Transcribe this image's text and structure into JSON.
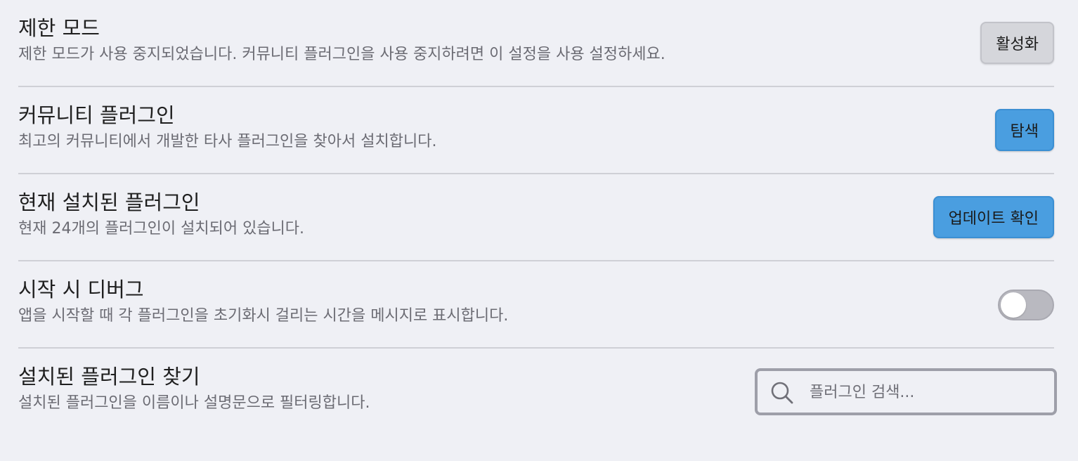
{
  "settings": {
    "restricted_mode": {
      "name": "제한 모드",
      "desc": "제한 모드가 사용 중지되었습니다. 커뮤니티 플러그인을 사용 중지하려면 이 설정을 사용 설정하세요.",
      "button": "활성화"
    },
    "community_plugins": {
      "name": "커뮤니티 플러그인",
      "desc": "최고의 커뮤니티에서 개발한 타사 플러그인을 찾아서 설치합니다.",
      "button": "탐색"
    },
    "installed_plugins": {
      "name": "현재 설치된 플러그인",
      "desc": "현재 24개의 플러그인이 설치되어 있습니다.",
      "button": "업데이트 확인"
    },
    "debug_startup": {
      "name": "시작 시 디버그",
      "desc": "앱을 시작할 때 각 플러그인을 초기화시 걸리는 시간을 메시지로 표시합니다.",
      "enabled": false
    },
    "search_plugins": {
      "name": "설치된 플러그인 찾기",
      "desc": "설치된 플러그인을 이름이나 설명문으로 필터링합니다.",
      "placeholder": "플러그인 검색...",
      "value": ""
    }
  },
  "icons": {
    "search": "search-icon"
  },
  "colors": {
    "background": "#eff0f5",
    "accent_button": "#4a9ee0",
    "neutral_button": "#d5d6db",
    "divider": "#cfd0d6",
    "toggle_off": "#b9b9c0"
  }
}
